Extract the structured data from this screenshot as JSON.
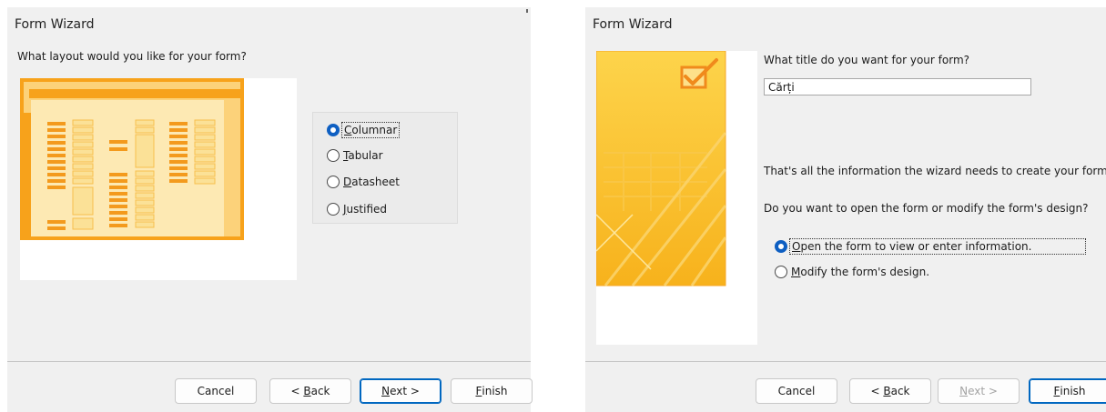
{
  "left_dialog": {
    "title": "Form Wizard",
    "question": "What layout would you like for your form?",
    "layouts": [
      {
        "label": "Columnar",
        "access_key": "C",
        "rest": "olumnar",
        "selected": true
      },
      {
        "label": "Tabular",
        "access_key": "T",
        "rest": "abular",
        "selected": false
      },
      {
        "label": "Datasheet",
        "access_key": "D",
        "rest": "atasheet",
        "selected": false
      },
      {
        "label": "Justified",
        "access_key": "J",
        "rest": "ustified",
        "selected": false
      }
    ],
    "buttons": {
      "cancel": "Cancel",
      "back_prefix": "< ",
      "back_key": "B",
      "back_rest": "ack",
      "next_key": "N",
      "next_rest": "ext >",
      "finish_key": "F",
      "finish_rest": "inish"
    }
  },
  "right_dialog": {
    "title": "Form Wizard",
    "title_prompt": "What title do you want for your form?",
    "form_title_value": "Cărți",
    "info_text": "That's all the information the wizard needs to create your form.",
    "open_question": "Do you want to open the form or modify the form's design?",
    "options": [
      {
        "access_key": "O",
        "rest": "pen the form to view or enter information.",
        "selected": true
      },
      {
        "access_key": "M",
        "rest": "odify the form's design.",
        "selected": false
      }
    ],
    "buttons": {
      "cancel": "Cancel",
      "back_prefix": "< ",
      "back_key": "B",
      "back_rest": "ack",
      "next_key": "N",
      "next_rest": "ext >",
      "finish_key": "F",
      "finish_rest": "inish",
      "next_enabled": false
    }
  },
  "colors": {
    "dialog_bg": "#f0f0f0",
    "accent_blue": "#0067c0",
    "preview_orange": "#f7a21b",
    "preview_light": "#fde9b3",
    "art_yellow": "#fbbf1e"
  },
  "icons": [
    "layout-preview-illustration",
    "checkmark-box-icon",
    "radio-checked",
    "radio-unchecked"
  ]
}
